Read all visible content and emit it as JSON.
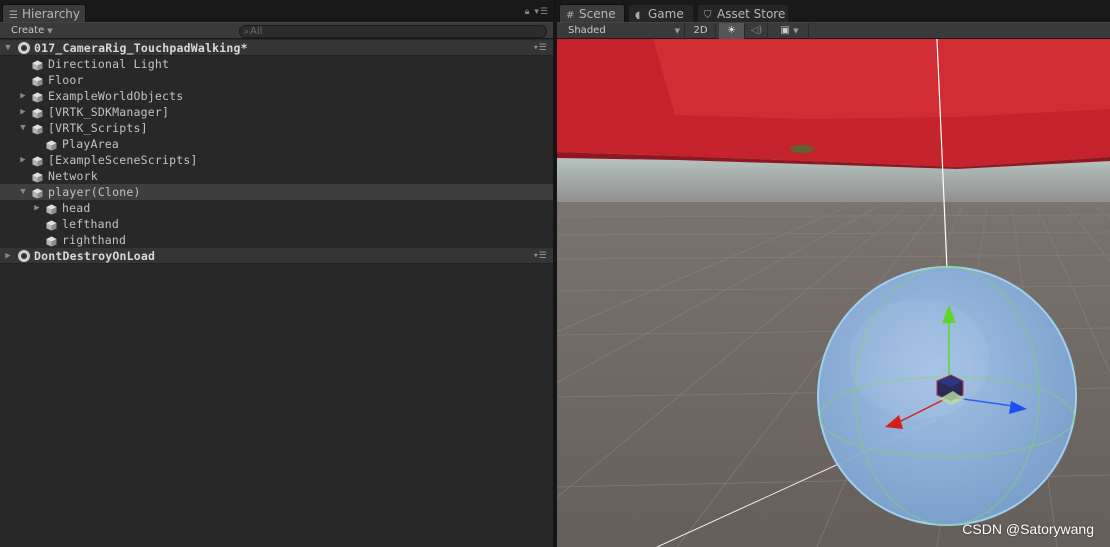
{
  "hierarchy": {
    "tab_label": "Hierarchy",
    "create_label": "Create",
    "search_placeholder": "All",
    "items": [
      {
        "label": "017_CameraRig_TouchpadWalking*",
        "type": "scene",
        "expanded": true
      },
      {
        "label": "Directional Light",
        "depth": 1
      },
      {
        "label": "Floor",
        "depth": 1
      },
      {
        "label": "ExampleWorldObjects",
        "depth": 1,
        "arrow": "right"
      },
      {
        "label": "[VRTK_SDKManager]",
        "depth": 1,
        "arrow": "right"
      },
      {
        "label": "[VRTK_Scripts]",
        "depth": 1,
        "arrow": "down"
      },
      {
        "label": "PlayArea",
        "depth": 2
      },
      {
        "label": "[ExampleSceneScripts]",
        "depth": 1,
        "arrow": "right"
      },
      {
        "label": "Network",
        "depth": 1
      },
      {
        "label": "player(Clone)",
        "depth": 1,
        "arrow": "down",
        "selected": true
      },
      {
        "label": "head",
        "depth": 2,
        "arrow": "right"
      },
      {
        "label": "lefthand",
        "depth": 2
      },
      {
        "label": "righthand",
        "depth": 2
      },
      {
        "label": "DontDestroyOnLoad",
        "type": "scene",
        "expanded": false
      }
    ]
  },
  "scene_view": {
    "tabs": [
      {
        "label": "Scene",
        "icon": "grid-icon",
        "active": true
      },
      {
        "label": "Game",
        "icon": "pacman-icon",
        "active": false
      },
      {
        "label": "Asset Store",
        "icon": "bag-icon",
        "active": false
      }
    ],
    "shading_mode": "Shaded",
    "mode_2d_label": "2D",
    "watermark": "CSDN @Satorywang",
    "colors": {
      "red_object": "#c0212b",
      "sky": "#e6f4f2",
      "floor": "#6e6864",
      "sphere": "#8fb8e6",
      "gizmo_y": "#5fd629",
      "gizmo_x": "#d0201c",
      "gizmo_z": "#1f4ef0"
    }
  }
}
